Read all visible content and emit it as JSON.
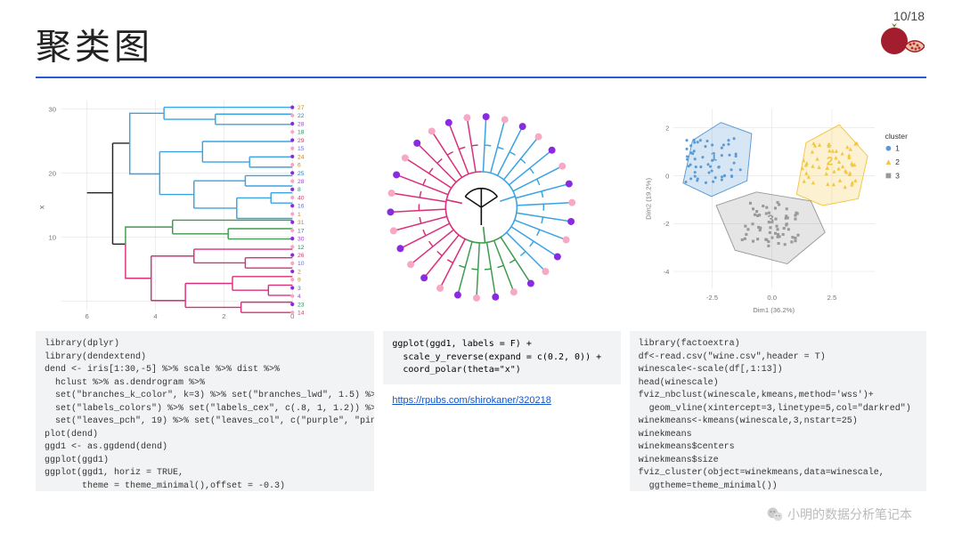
{
  "page": {
    "current": 10,
    "total": 18,
    "display": "10/18"
  },
  "title": "聚类图",
  "link": {
    "label": "https://rpubs.com/shirokaner/320218",
    "href": "https://rpubs.com/shirokaner/320218"
  },
  "watermark": "小明的数据分析笔记本",
  "code_left": "library(dplyr)\nlibrary(dendextend)\ndend <- iris[1:30,-5] %>% scale %>% dist %>%\n  hclust %>% as.dendrogram %>%\n  set(\"branches_k_color\", k=3) %>% set(\"branches_lwd\", 1.5) %>%\n  set(\"labels_colors\") %>% set(\"labels_cex\", c(.8, 1, 1.2)) %>%\n  set(\"leaves_pch\", 19) %>% set(\"leaves_col\", c(\"purple\", \"pink\"))\nplot(dend)\nggd1 <- as.ggdend(dend)\nggplot(ggd1)\nggplot(ggd1, horiz = TRUE,\n       theme = theme_minimal(),offset = -0.3)",
  "code_mid": "ggplot(ggd1, labels = F) +\n  scale_y_reverse(expand = c(0.2, 0)) +\n  coord_polar(theta=\"x\")",
  "code_right": "library(factoextra)\ndf<-read.csv(\"wine.csv\",header = T)\nwinescale<-scale(df[,1:13])\nhead(winescale)\nfviz_nbclust(winescale,kmeans,method='wss')+\n  geom_vline(xintercept=3,linetype=5,col=\"darkred\")\nwinekmeans<-kmeans(winescale,3,nstart=25)\nwinekmeans\nwinekmeans$centers\nwinekmeans$size\nfviz_cluster(object=winekmeans,data=winescale,\n  ggtheme=theme_minimal())",
  "chart_data": [
    {
      "type": "dendrogram",
      "orientation": "horizontal",
      "title": "",
      "xlabel": "x",
      "ylabel": "",
      "y_ticks": [
        10,
        20,
        30
      ],
      "x_ticks": [
        0,
        2,
        4,
        6
      ],
      "clusters": 3,
      "cluster_colors": [
        "#3aa3e3",
        "#3e9b4f",
        "#d9307b"
      ],
      "leaf_colors": [
        "purple",
        "pink"
      ],
      "leaf_labels": [
        27,
        22,
        28,
        18,
        29,
        15,
        24,
        6,
        25,
        28,
        8,
        40,
        16,
        1,
        31,
        17,
        30,
        12,
        26,
        10,
        2,
        9,
        3,
        4,
        23,
        14
      ],
      "n_leaves": 30
    },
    {
      "type": "dendrogram",
      "layout": "circular",
      "title": "",
      "clusters": 3,
      "cluster_colors": [
        "#3aa3e3",
        "#3e9b4f",
        "#d9307b"
      ],
      "leaf_colors": [
        "purple",
        "pink"
      ],
      "n_leaves": 30
    },
    {
      "type": "scatter",
      "title": "",
      "xlabel": "Dim1 (36.2%)",
      "ylabel": "Dim2 (19.2%)",
      "xlim": [
        -4,
        4.5
      ],
      "ylim": [
        -4.5,
        3.5
      ],
      "x_ticks": [
        -2.5,
        0.0,
        2.5
      ],
      "y_ticks": [
        -4,
        -2,
        0,
        2
      ],
      "legend_title": "cluster",
      "clusters": [
        {
          "name": "1",
          "color": "#5b9bd5",
          "shape": "circle",
          "centroid": [
            -2.3,
            1.2
          ],
          "n_points": 55,
          "hull": [
            [
              -3.6,
              0.2
            ],
            [
              -3.2,
              2.1
            ],
            [
              -2.0,
              2.9
            ],
            [
              -0.7,
              2.4
            ],
            [
              -0.9,
              0.3
            ],
            [
              -2.4,
              -0.4
            ]
          ]
        },
        {
          "name": "2",
          "color": "#f2c744",
          "shape": "triangle",
          "centroid": [
            2.6,
            1.0
          ],
          "n_points": 50,
          "hull": [
            [
              1.2,
              -0.3
            ],
            [
              1.6,
              2.0
            ],
            [
              3.0,
              2.8
            ],
            [
              4.2,
              1.4
            ],
            [
              3.8,
              -0.5
            ],
            [
              2.3,
              -0.8
            ]
          ]
        },
        {
          "name": "3",
          "color": "#999999",
          "shape": "square",
          "centroid": [
            0.1,
            -1.6
          ],
          "n_points": 60,
          "hull": [
            [
              -2.2,
              -0.8
            ],
            [
              -0.5,
              -0.2
            ],
            [
              1.8,
              -0.6
            ],
            [
              2.4,
              -2.0
            ],
            [
              0.8,
              -3.4
            ],
            [
              -1.4,
              -2.8
            ]
          ]
        }
      ]
    }
  ]
}
